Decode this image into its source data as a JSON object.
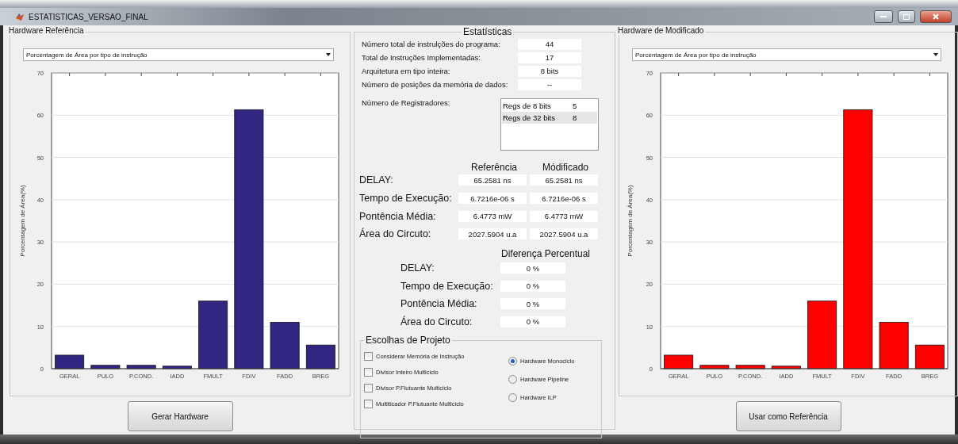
{
  "window": {
    "title": "ESTATISTICAS_VERSAO_FINAL"
  },
  "panels": [
    {
      "title": "Hardware Referência",
      "dropdown": "Porcentagem de Área por tipo de instrução",
      "button": "Gerar Hardware",
      "chart_data": {
        "type": "bar",
        "ylabel": "Porcentagem de Área(%)",
        "categories": [
          "GERAL",
          "PULO",
          "P.COND.",
          "IADD",
          "FMULT",
          "FDIV",
          "FADD",
          "BREG"
        ],
        "grid": true,
        "series": [
          {
            "color": "#312783",
            "values": [
              3.2,
              0.8,
              0.8,
              0.6,
              16,
              61.3,
              11,
              5.6
            ]
          }
        ],
        "ylim": [
          0,
          70
        ],
        "yticks": [
          0,
          10,
          20,
          30,
          40,
          50,
          60,
          70
        ]
      }
    },
    {
      "title": "Hardware de Modificado",
      "dropdown": "Porcentagem de Área por tipo de instrução",
      "button": "Usar como Referência",
      "chart_data": {
        "type": "bar",
        "ylabel": "Porcentagem de Área(%)",
        "categories": [
          "GERAL",
          "PULO",
          "P.COND.",
          "IADD",
          "FMULT",
          "FDIV",
          "FADD",
          "BREG"
        ],
        "grid": true,
        "series": [
          {
            "color": "#ff0000",
            "values": [
              3.2,
              0.8,
              0.8,
              0.6,
              16,
              61.3,
              11,
              5.6
            ]
          }
        ],
        "ylim": [
          0,
          70
        ],
        "yticks": [
          0,
          10,
          20,
          30,
          40,
          50,
          60,
          70
        ]
      }
    }
  ],
  "stats": {
    "title": "Estatísticas",
    "summary": [
      {
        "label": "Número total de instrulções do programa:",
        "value": "44"
      },
      {
        "label": "Total de Instruções Implementadas:",
        "value": "17"
      },
      {
        "label": "Arquitetura em tipo inteira:",
        "value": "8 bits"
      },
      {
        "label": "Número de posições da memória de dados:",
        "value": "--"
      }
    ],
    "registers": {
      "label": "Número de Registradores:",
      "items": [
        {
          "name": "Regs de 8 bits",
          "count": "5",
          "selected": false
        },
        {
          "name": "Regs de 32 bits",
          "count": "8",
          "selected": true
        }
      ]
    },
    "comparison": {
      "headers": [
        "Referência",
        "Módificado"
      ],
      "rows": [
        {
          "label": "DELAY:",
          "reference": "65.2581 ns",
          "modified": "65.2581 ns"
        },
        {
          "label": "Tempo de Execução:",
          "reference": "6.7216e-06 s",
          "modified": "6.7216e-06 s"
        },
        {
          "label": "Pontência Média:",
          "reference": "6.4773 mW",
          "modified": "6.4773 mW"
        },
        {
          "label": "Área do Circuto:",
          "reference": "2027.5904 u.a",
          "modified": "2027.5904 u.a"
        }
      ]
    },
    "difference": {
      "title": "Diferença Percentual",
      "rows": [
        {
          "label": "DELAY:",
          "value": "0 %"
        },
        {
          "label": "Tempo de Execução:",
          "value": "0 %"
        },
        {
          "label": "Pontência Média:",
          "value": "0 %"
        },
        {
          "label": "Área do Circuto:",
          "value": "0 %"
        }
      ]
    },
    "choices": {
      "title": "Escolhas de Projeto",
      "checkboxes": [
        {
          "label": "Considerar Memória de Instrução",
          "checked": false
        },
        {
          "label": "Divisor Inteiro Multiciclo",
          "checked": false
        },
        {
          "label": "Divisor P.Flutuante Multiciclo",
          "checked": false
        },
        {
          "label": "Multiticador P.Flutuante Multiciclo",
          "checked": false
        }
      ],
      "radios": [
        {
          "label": "Hardware Monociclo",
          "selected": true
        },
        {
          "label": "Hardware Pipeline",
          "selected": false
        },
        {
          "label": "Hardware ILP",
          "selected": false
        }
      ]
    }
  }
}
